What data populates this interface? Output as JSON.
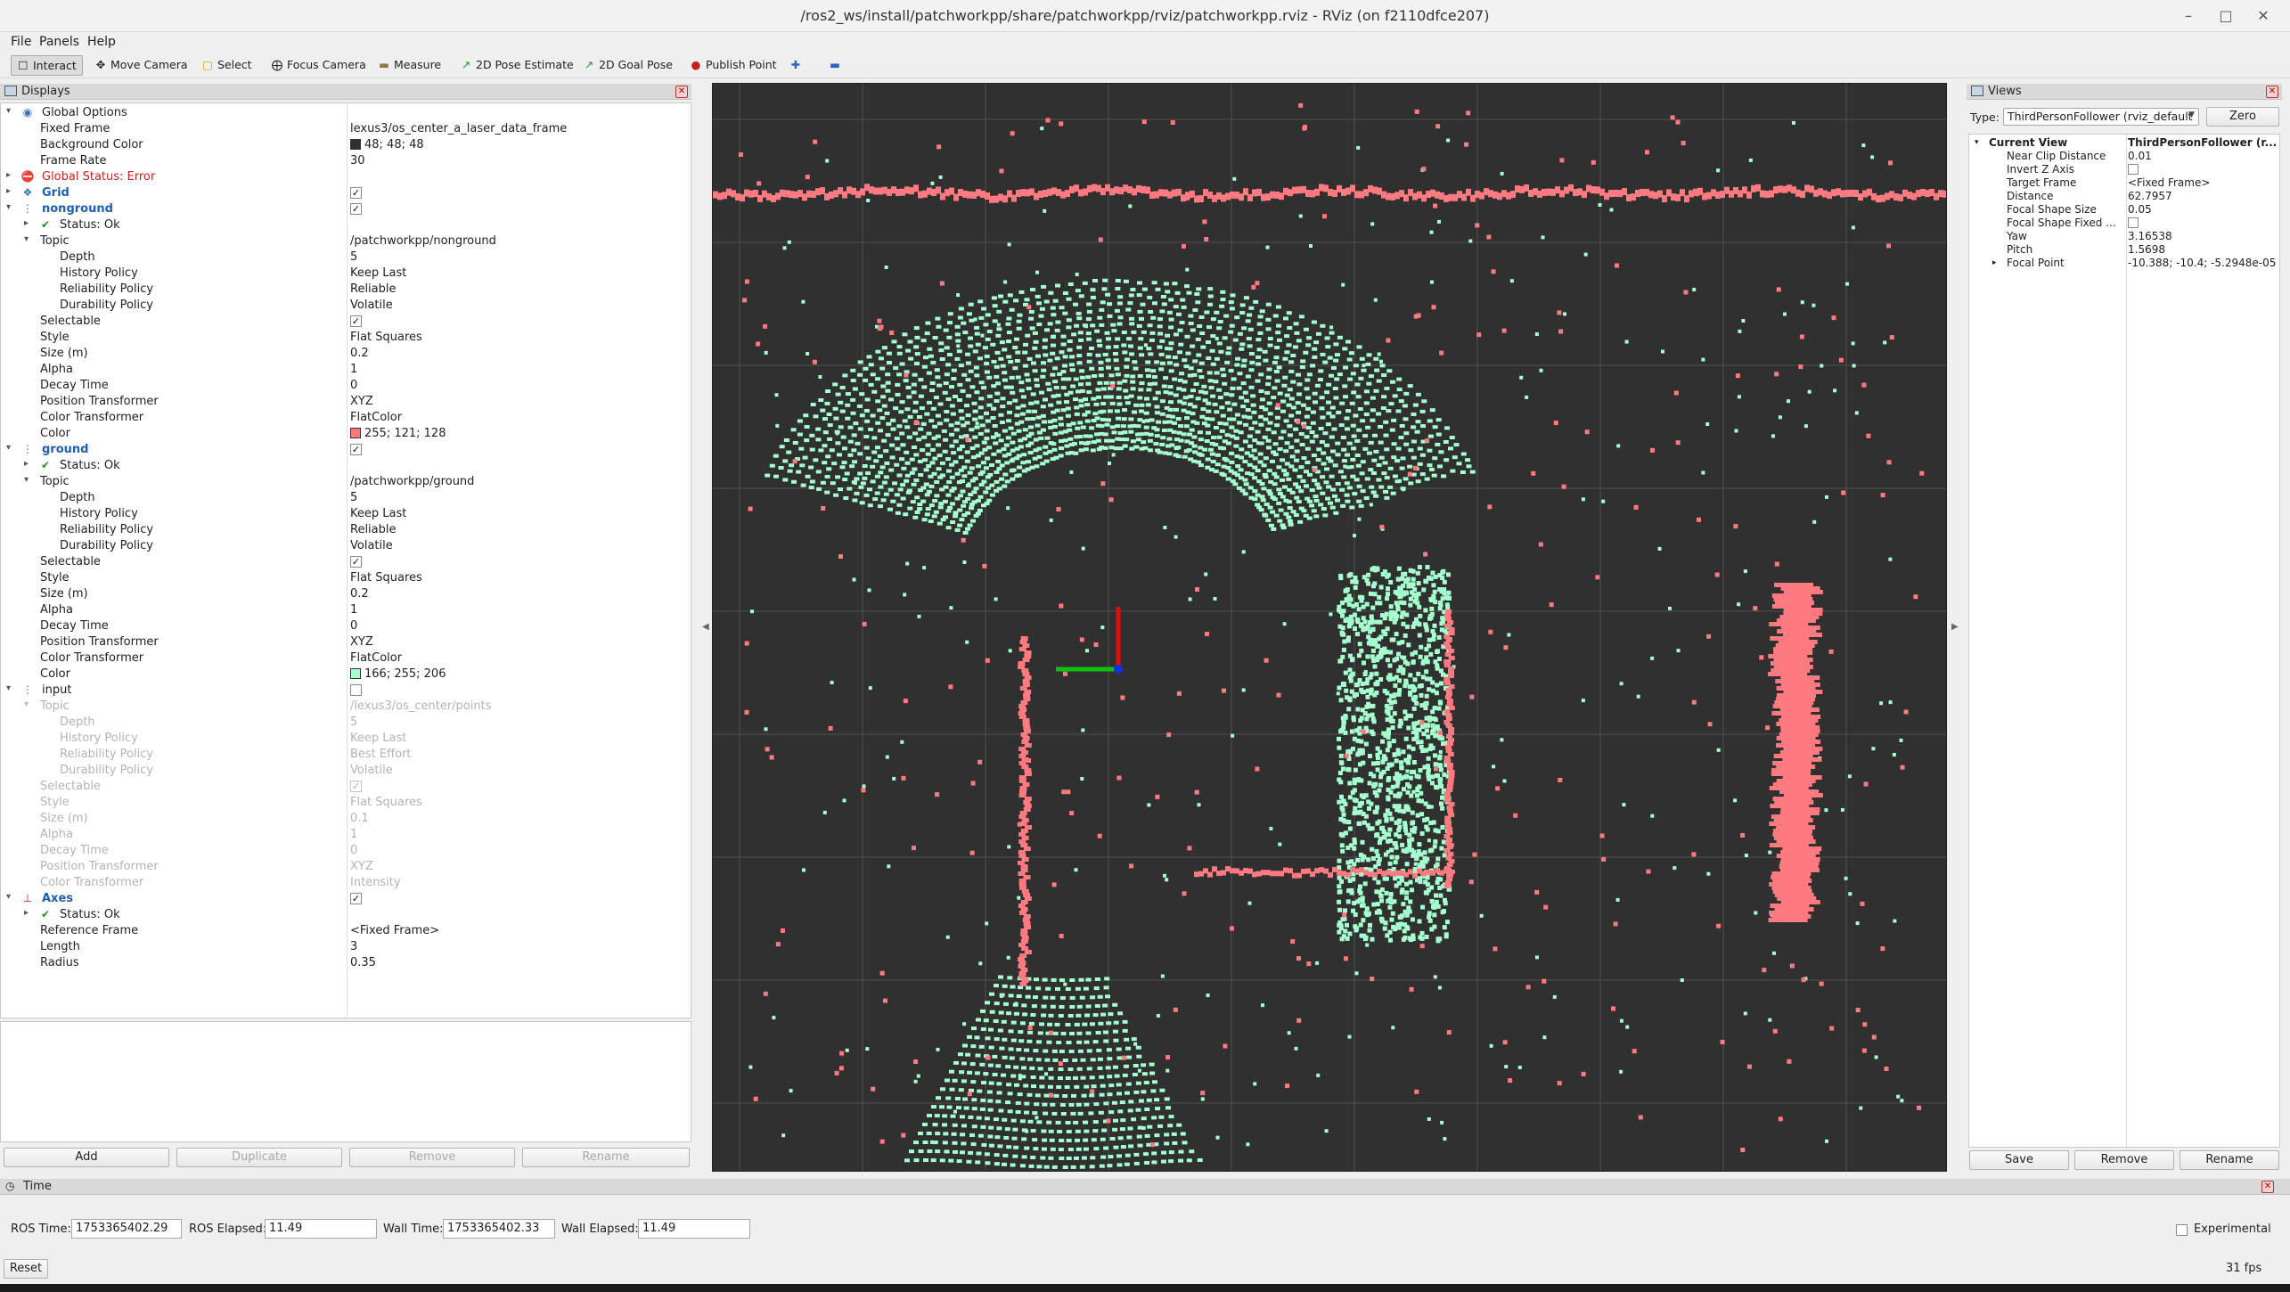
{
  "window": {
    "title": "/ros2_ws/install/patchworkpp/share/patchworkpp/rviz/patchworkpp.rviz - RViz (on f2110dfce207)"
  },
  "menu": [
    "File",
    "Panels",
    "Help"
  ],
  "toolbar": {
    "interact": "Interact",
    "move_camera": "Move Camera",
    "select": "Select",
    "focus_camera": "Focus Camera",
    "measure": "Measure",
    "pose_estimate": "2D Pose Estimate",
    "goal_pose": "2D Goal Pose",
    "publish_point": "Publish Point"
  },
  "displays": {
    "title": "Displays",
    "rows": {
      "global_options": "Global Options",
      "fixed_frame": [
        "Fixed Frame",
        "lexus3/os_center_a_laser_data_frame"
      ],
      "background_color": [
        "Background Color",
        "48; 48; 48"
      ],
      "frame_rate": [
        "Frame Rate",
        "30"
      ],
      "global_status": "Global Status: Error",
      "grid": "Grid",
      "nonground": "nonground",
      "ng_status": "Status: Ok",
      "ng_topic": [
        "Topic",
        "/patchworkpp/nonground"
      ],
      "ng_depth": [
        "Depth",
        "5"
      ],
      "ng_history": [
        "History Policy",
        "Keep Last"
      ],
      "ng_reliability": [
        "Reliability Policy",
        "Reliable"
      ],
      "ng_durability": [
        "Durability Policy",
        "Volatile"
      ],
      "ng_selectable": "Selectable",
      "ng_style": [
        "Style",
        "Flat Squares"
      ],
      "ng_size": [
        "Size (m)",
        "0.2"
      ],
      "ng_alpha": [
        "Alpha",
        "1"
      ],
      "ng_decay": [
        "Decay Time",
        "0"
      ],
      "ng_position": [
        "Position Transformer",
        "XYZ"
      ],
      "ng_color_tf": [
        "Color Transformer",
        "FlatColor"
      ],
      "ng_color": [
        "Color",
        "255; 121; 128"
      ],
      "ground": "ground",
      "g_status": "Status: Ok",
      "g_topic": [
        "Topic",
        "/patchworkpp/ground"
      ],
      "g_depth": [
        "Depth",
        "5"
      ],
      "g_history": [
        "History Policy",
        "Keep Last"
      ],
      "g_reliability": [
        "Reliability Policy",
        "Reliable"
      ],
      "g_durability": [
        "Durability Policy",
        "Volatile"
      ],
      "g_selectable": "Selectable",
      "g_style": [
        "Style",
        "Flat Squares"
      ],
      "g_size": [
        "Size (m)",
        "0.2"
      ],
      "g_alpha": [
        "Alpha",
        "1"
      ],
      "g_decay": [
        "Decay Time",
        "0"
      ],
      "g_position": [
        "Position Transformer",
        "XYZ"
      ],
      "g_color_tf": [
        "Color Transformer",
        "FlatColor"
      ],
      "g_color": [
        "Color",
        "166; 255; 206"
      ],
      "input": "input",
      "i_topic": [
        "Topic",
        "/lexus3/os_center/points"
      ],
      "i_depth": [
        "Depth",
        "5"
      ],
      "i_history": [
        "History Policy",
        "Keep Last"
      ],
      "i_reliability": [
        "Reliability Policy",
        "Best Effort"
      ],
      "i_durability": [
        "Durability Policy",
        "Volatile"
      ],
      "i_selectable": "Selectable",
      "i_style": [
        "Style",
        "Flat Squares"
      ],
      "i_size": [
        "Size (m)",
        "0.1"
      ],
      "i_alpha": [
        "Alpha",
        "1"
      ],
      "i_decay": [
        "Decay Time",
        "0"
      ],
      "i_position": [
        "Position Transformer",
        "XYZ"
      ],
      "i_color_tf": [
        "Color Transformer",
        "Intensity"
      ],
      "axes": "Axes",
      "a_status": "Status: Ok",
      "a_ref": [
        "Reference Frame",
        "<Fixed Frame>"
      ],
      "a_length": [
        "Length",
        "3"
      ],
      "a_radius": [
        "Radius",
        "0.35"
      ]
    },
    "buttons": {
      "add": "Add",
      "duplicate": "Duplicate",
      "remove": "Remove",
      "rename": "Rename"
    }
  },
  "views": {
    "title": "Views",
    "type_label": "Type:",
    "type_value": "ThirdPersonFollower (rviz_default",
    "zero": "Zero",
    "current_view": [
      "Current View",
      "ThirdPersonFollower (r..."
    ],
    "rows": [
      [
        "Near Clip Distance",
        "0.01"
      ],
      [
        "Invert Z Axis",
        ""
      ],
      [
        "Target Frame",
        "<Fixed Frame>"
      ],
      [
        "Distance",
        "62.7957"
      ],
      [
        "Focal Shape Size",
        "0.05"
      ],
      [
        "Focal Shape Fixed ...",
        ""
      ],
      [
        "Yaw",
        "3.16538"
      ],
      [
        "Pitch",
        "1.5698"
      ],
      [
        "Focal Point",
        "-10.388; -10.4; -5.2948e-05"
      ]
    ],
    "buttons": {
      "save": "Save",
      "remove": "Remove",
      "rename": "Rename"
    }
  },
  "time": {
    "title": "Time",
    "ros_time_label": "ROS Time:",
    "ros_time": "1753365402.29",
    "ros_elapsed_label": "ROS Elapsed:",
    "ros_elapsed": "11.49",
    "wall_time_label": "Wall Time:",
    "wall_time": "1753365402.33",
    "wall_elapsed_label": "Wall Elapsed:",
    "wall_elapsed": "11.49",
    "experimental": "Experimental",
    "reset": "Reset",
    "fps": "31 fps"
  },
  "colors": {
    "background": "#303030",
    "nonground": "#ff7980",
    "ground": "#a6ffce"
  }
}
